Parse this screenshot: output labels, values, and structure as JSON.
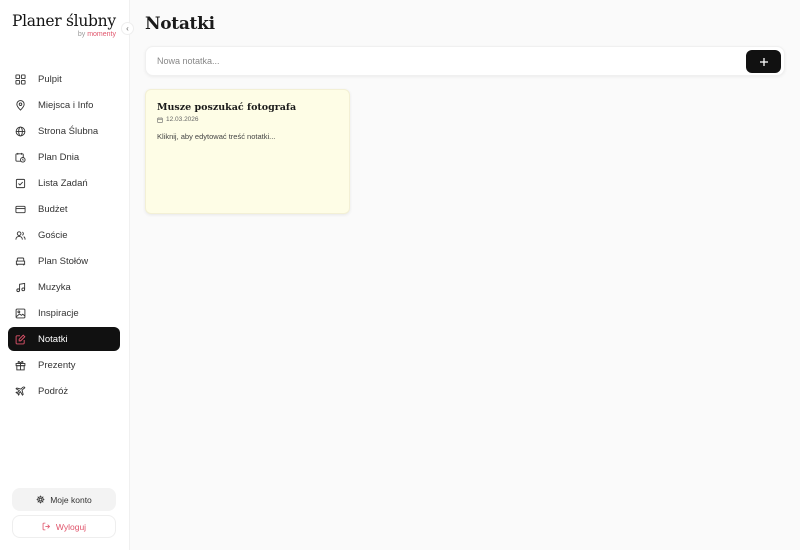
{
  "brand": {
    "title": "Planer ślubny",
    "by": "by",
    "name": "momenty"
  },
  "sidebar": {
    "items": [
      {
        "label": "Pulpit",
        "icon": "grid-icon",
        "active": false
      },
      {
        "label": "Miejsca i Info",
        "icon": "map-pin-icon",
        "active": false
      },
      {
        "label": "Strona Ślubna",
        "icon": "globe-icon",
        "active": false
      },
      {
        "label": "Plan Dnia",
        "icon": "calendar-clock-icon",
        "active": false
      },
      {
        "label": "Lista Zadań",
        "icon": "checkbox-icon",
        "active": false
      },
      {
        "label": "Budżet",
        "icon": "credit-card-icon",
        "active": false
      },
      {
        "label": "Goście",
        "icon": "users-icon",
        "active": false
      },
      {
        "label": "Plan Stołów",
        "icon": "sofa-icon",
        "active": false
      },
      {
        "label": "Muzyka",
        "icon": "music-icon",
        "active": false
      },
      {
        "label": "Inspiracje",
        "icon": "image-icon",
        "active": false
      },
      {
        "label": "Notatki",
        "icon": "note-edit-icon",
        "active": true
      },
      {
        "label": "Prezenty",
        "icon": "gift-icon",
        "active": false
      },
      {
        "label": "Podróż",
        "icon": "plane-icon",
        "active": false
      }
    ],
    "account_label": "Moje konto",
    "logout_label": "Wyloguj"
  },
  "main": {
    "title": "Notatki",
    "new_note": {
      "placeholder": "Nowa notatka...",
      "value": ""
    },
    "notes": [
      {
        "title": "Musze poszukać fotografa",
        "date": "12.03.2026",
        "body": "Kliknij, aby edytować treść notatki..."
      }
    ]
  },
  "colors": {
    "accent": "#e0546b",
    "active_bg": "#111111",
    "note_bg": "#fefde6",
    "page_bg": "#fafafa"
  }
}
